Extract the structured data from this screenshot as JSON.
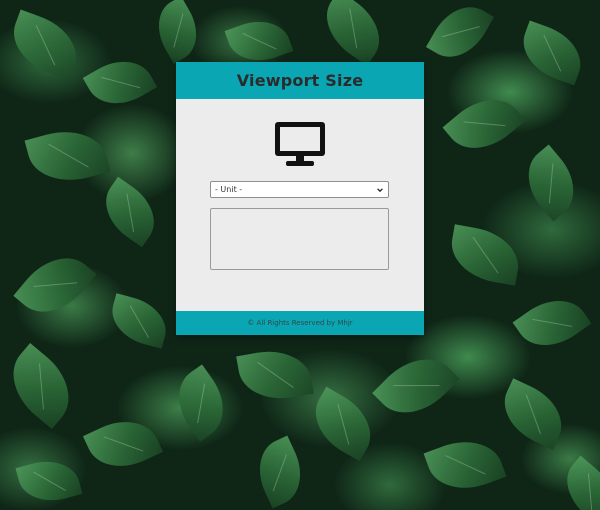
{
  "background": {
    "description_icon": "leaves-background"
  },
  "card": {
    "title": "Viewport Size",
    "icon": "desktop-monitor-icon",
    "unit_select": {
      "selected": "- Unit -"
    },
    "result_text": "",
    "footer": "© All Rights Reserved by Mhjr"
  },
  "colors": {
    "accent": "#0aa6b3",
    "card_bg": "#ececec",
    "title_text": "#2b2b2b",
    "icon": "#111111"
  }
}
